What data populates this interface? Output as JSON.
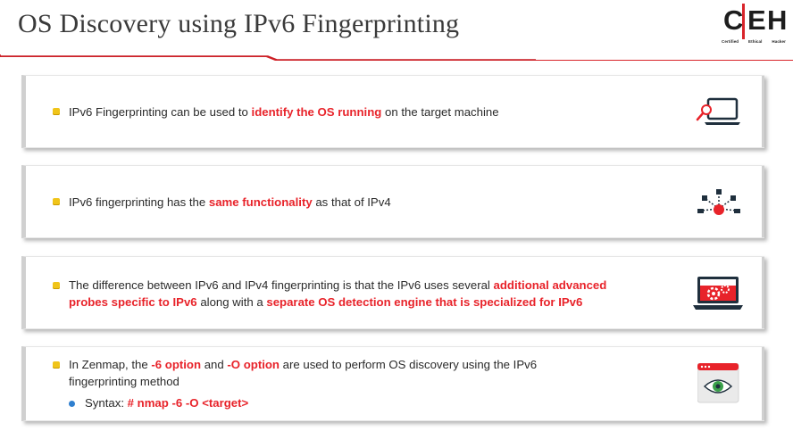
{
  "title": "OS Discovery using IPv6 Fingerprinting",
  "logo": {
    "letters": [
      "C",
      "E",
      "H"
    ],
    "sub": [
      "Certified",
      "Ethical",
      "Hacker"
    ],
    "accent": "#d9242a"
  },
  "colors": {
    "highlight": "#e8232a",
    "bullet": "#f0c419",
    "sub_bullet": "#2f7fcf"
  },
  "items": [
    {
      "icon": "laptop-magnifier-icon",
      "parts": [
        {
          "t": "IPv6 Fingerprinting can be used to "
        },
        {
          "t": "identify the OS running",
          "h": true
        },
        {
          "t": " on the target machine"
        }
      ]
    },
    {
      "icon": "network-nodes-icon",
      "parts": [
        {
          "t": "IPv6 fingerprinting has the "
        },
        {
          "t": "same functionality",
          "h": true
        },
        {
          "t": " as that of IPv4"
        }
      ]
    },
    {
      "icon": "laptop-gears-icon",
      "line1": [
        {
          "t": "The difference between IPv6 and IPv4 fingerprinting is that the IPv6 uses several "
        },
        {
          "t": "additional advanced",
          "h": true
        }
      ],
      "line2": [
        {
          "t": "probes specific to IPv6",
          "h": true
        },
        {
          "t": " along with a "
        },
        {
          "t": "separate OS detection engine that is specialized for IPv6",
          "h": true
        }
      ]
    },
    {
      "icon": "browser-eye-icon",
      "line1": [
        {
          "t": "In Zenmap, the "
        },
        {
          "t": "-6 option",
          "h": true
        },
        {
          "t": " and "
        },
        {
          "t": "-O option",
          "h": true
        },
        {
          "t": " are used to perform OS discovery using the IPv6"
        }
      ],
      "line2": [
        {
          "t": "fingerprinting method"
        }
      ],
      "syntax_label": "Syntax: ",
      "syntax_cmd": "# nmap -6 -O <target>"
    }
  ]
}
